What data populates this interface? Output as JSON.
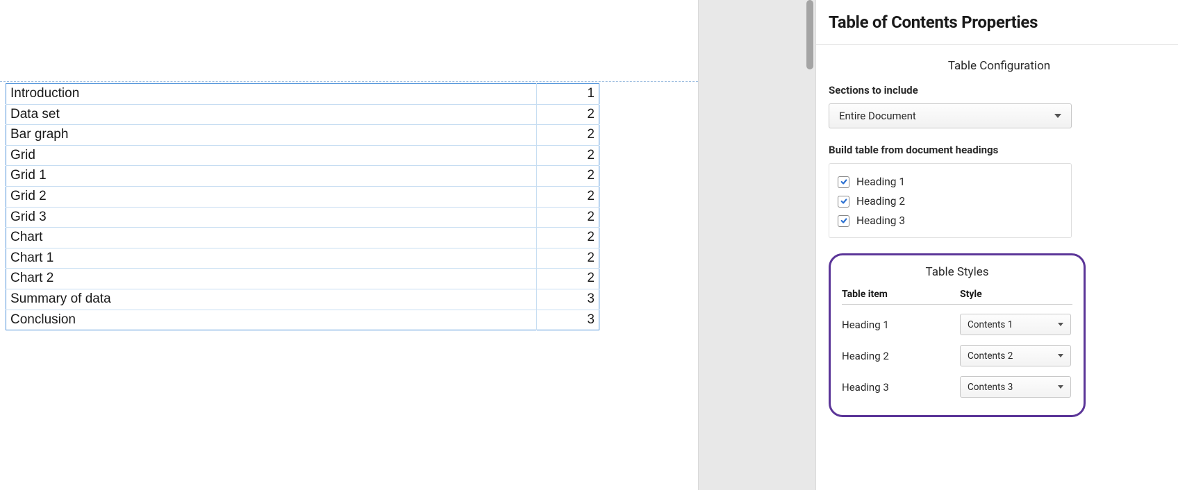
{
  "toc": {
    "rows": [
      {
        "title": "Introduction",
        "page": "1",
        "indent": 0
      },
      {
        "title": "Data set",
        "page": "2",
        "indent": 0
      },
      {
        "title": "Bar graph",
        "page": "2",
        "indent": 1
      },
      {
        "title": "Grid",
        "page": "2",
        "indent": 1
      },
      {
        "title": "Grid 1",
        "page": "2",
        "indent": 2
      },
      {
        "title": "Grid 2",
        "page": "2",
        "indent": 2
      },
      {
        "title": "Grid 3",
        "page": "2",
        "indent": 2
      },
      {
        "title": "Chart",
        "page": "2",
        "indent": 1
      },
      {
        "title": "Chart 1",
        "page": "2",
        "indent": 2
      },
      {
        "title": "Chart 2",
        "page": "2",
        "indent": 2
      },
      {
        "title": "Summary of data",
        "page": "3",
        "indent": 0
      },
      {
        "title": "Conclusion",
        "page": "3",
        "indent": 0
      }
    ]
  },
  "panel": {
    "title": "Table of Contents Properties",
    "config_heading": "Table Configuration",
    "sections_label": "Sections to include",
    "sections_value": "Entire Document",
    "build_label": "Build table from document headings",
    "headings": [
      {
        "label": "Heading 1",
        "checked": true
      },
      {
        "label": "Heading 2",
        "checked": true
      },
      {
        "label": "Heading 3",
        "checked": true
      }
    ],
    "styles_heading": "Table Styles",
    "styles_col_item": "Table item",
    "styles_col_style": "Style",
    "style_rows": [
      {
        "item": "Heading 1",
        "style": "Contents 1"
      },
      {
        "item": "Heading 2",
        "style": "Contents 2"
      },
      {
        "item": "Heading 3",
        "style": "Contents 3"
      }
    ]
  }
}
